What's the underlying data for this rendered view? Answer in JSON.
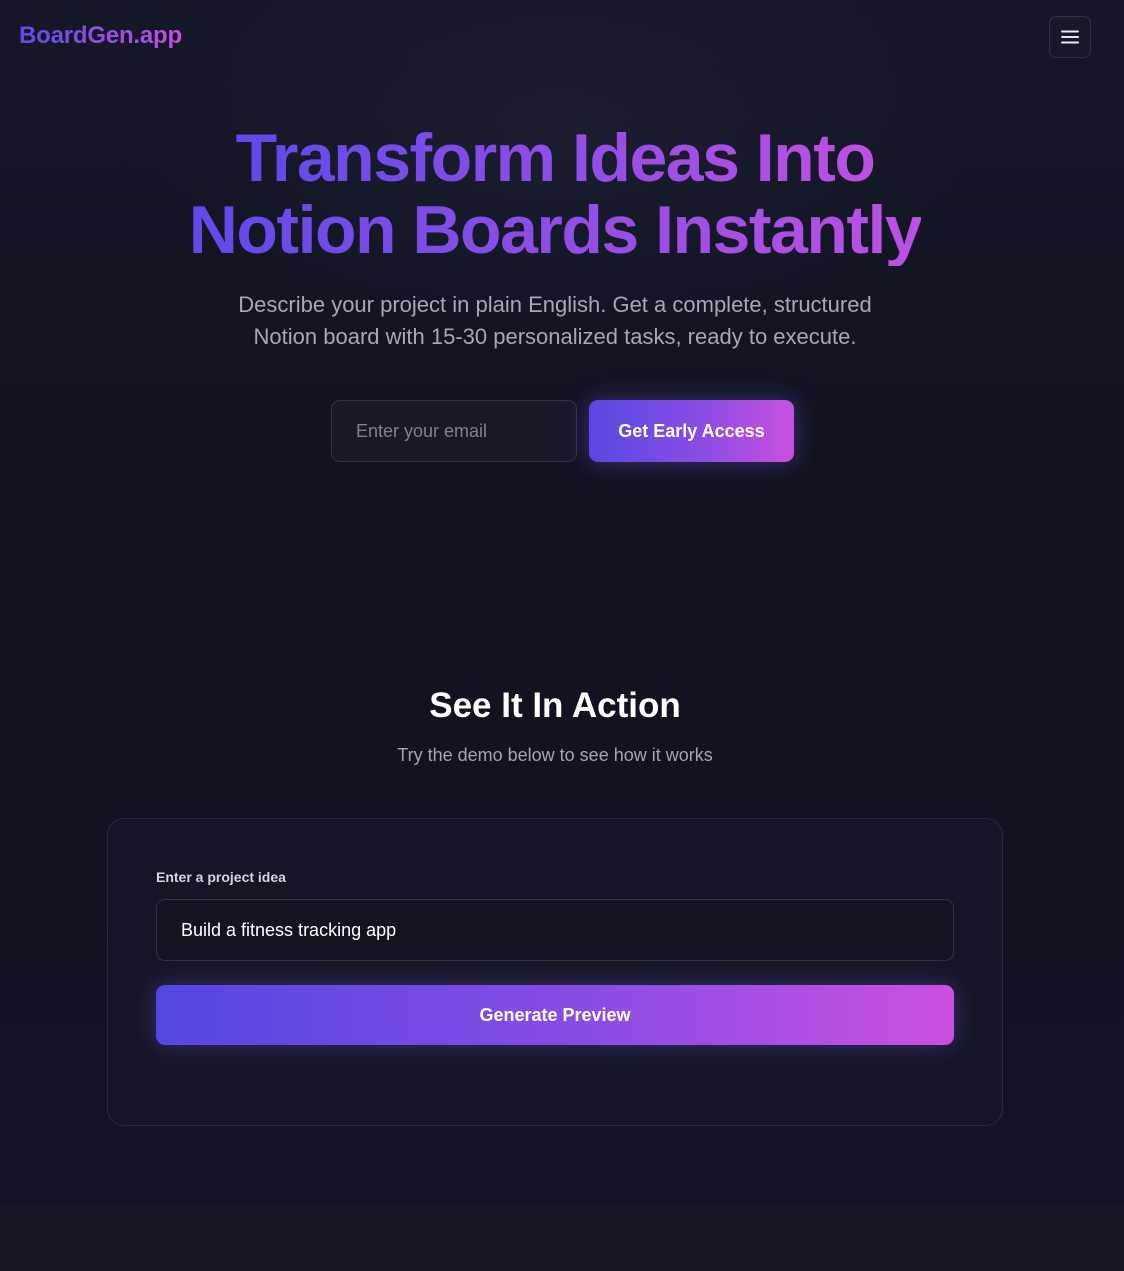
{
  "header": {
    "logo": "BoardGen.app",
    "menu_icon": "hamburger-menu-icon"
  },
  "hero": {
    "title_line1": "Transform Ideas Into",
    "title_line2": "Notion Boards Instantly",
    "subtitle_line1": "Describe your project in plain English. Get a complete, structured",
    "subtitle_line2": "Notion board with 15-30 personalized tasks, ready to execute.",
    "email_placeholder": "Enter your email",
    "cta_label": "Get Early Access"
  },
  "demo": {
    "title": "See It In Action",
    "subtitle": "Try the demo below to see how it works",
    "field_label": "Enter a project idea",
    "field_value": "Build a fitness tracking app",
    "button_label": "Generate Preview"
  },
  "colors": {
    "gradient_start": "#5848e3",
    "gradient_end": "#c94fe0",
    "background": "#10131f"
  }
}
